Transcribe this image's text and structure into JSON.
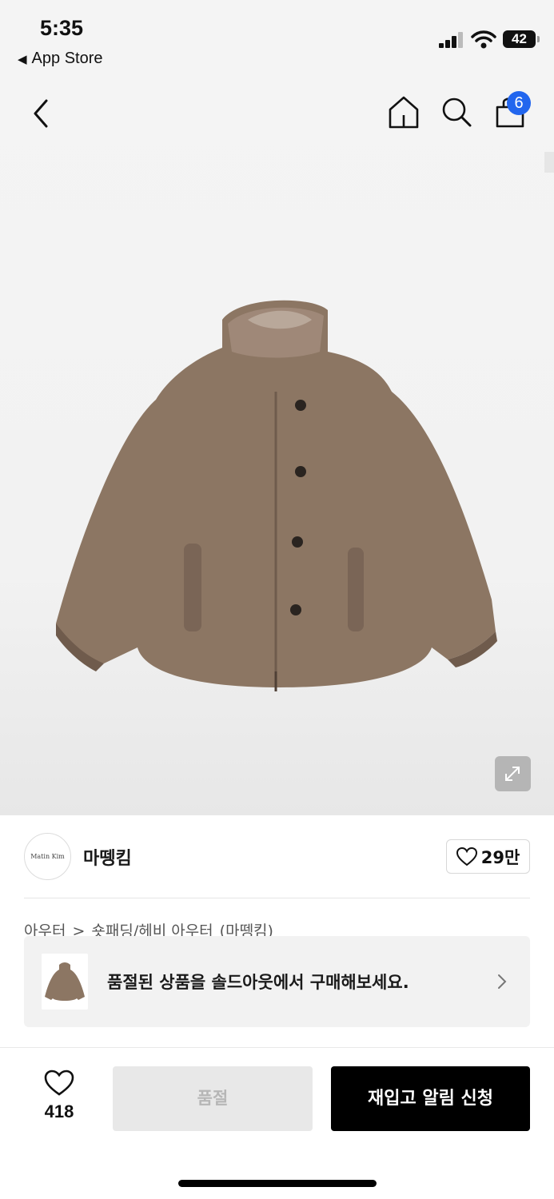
{
  "status_bar": {
    "time": "5:35",
    "back_label": "App Store",
    "battery": "42"
  },
  "nav": {
    "cart_count": "6",
    "icons": [
      "back-chevron-icon",
      "home-icon",
      "search-icon",
      "cart-bag-icon"
    ]
  },
  "brand": {
    "logo_text": "Matin Kim",
    "name": "마뗑킴",
    "likes": "29만"
  },
  "breadcrumb": [
    "아우터",
    ">",
    "숏패딩/헤비 아우터",
    "(마뗑킴)"
  ],
  "soldout_banner": {
    "text": "품절된 상품을 솔드아웃에서 구매해보세요."
  },
  "bottom": {
    "wish_count": "418",
    "soldout_label": "품절",
    "restock_label": "재입고 알림 신청"
  },
  "colors": {
    "accent": "#2266ee",
    "jacket": "#8c7663",
    "primary_button": "#000000"
  }
}
